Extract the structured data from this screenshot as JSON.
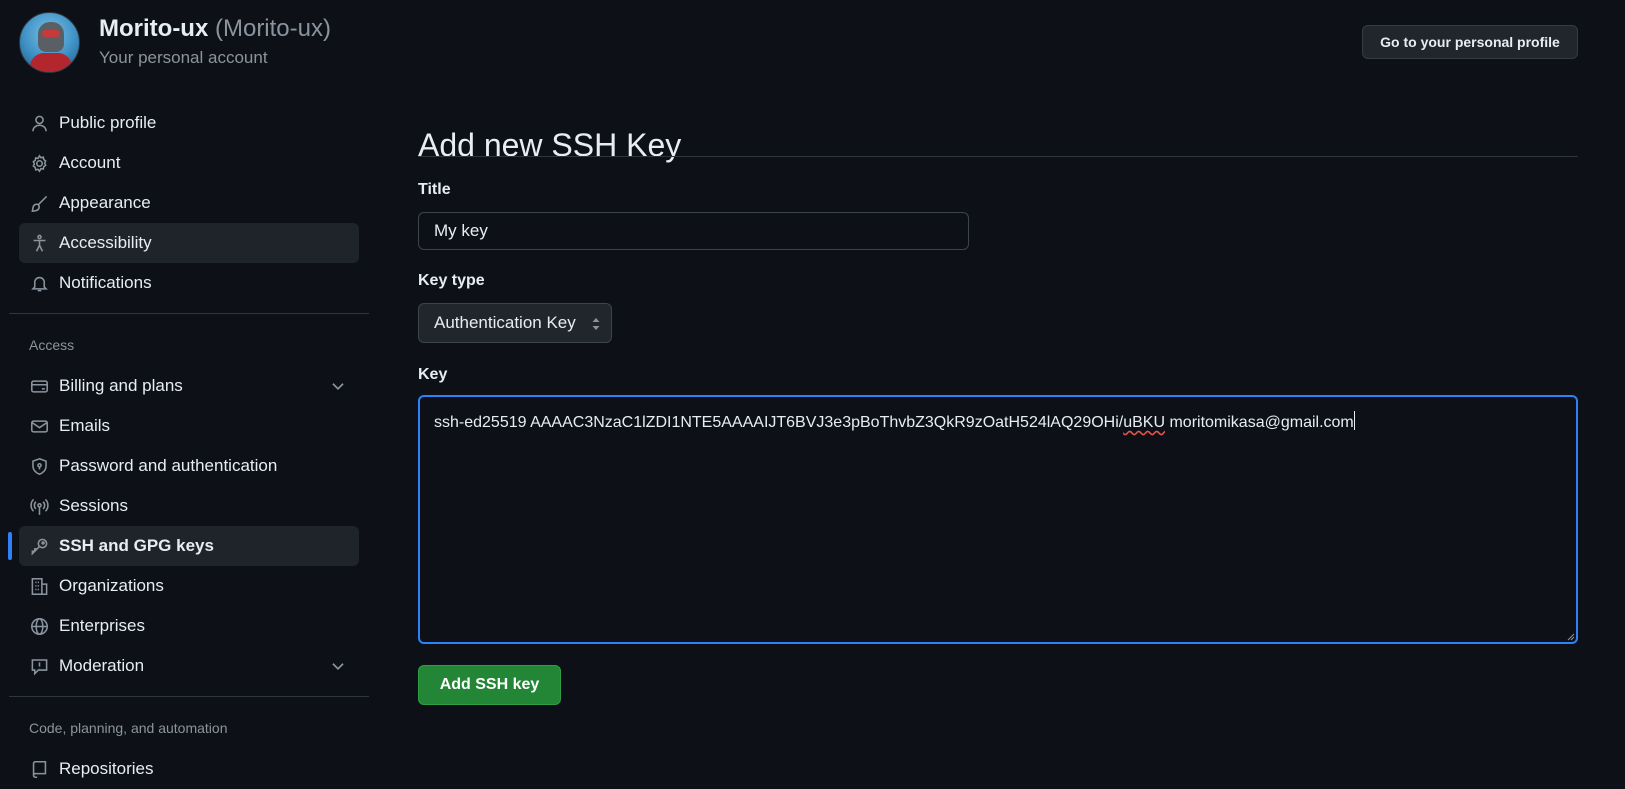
{
  "account": {
    "name": "Morito-ux",
    "handle": "(Morito-ux)",
    "subtitle": "Your personal account",
    "profile_button": "Go to your personal profile"
  },
  "sidebar": {
    "items": [
      {
        "label": "Public profile",
        "icon": "person-icon"
      },
      {
        "label": "Account",
        "icon": "gear-icon"
      },
      {
        "label": "Appearance",
        "icon": "paintbrush-icon"
      },
      {
        "label": "Accessibility",
        "icon": "accessibility-icon",
        "hover": true
      },
      {
        "label": "Notifications",
        "icon": "bell-icon"
      }
    ],
    "access_label": "Access",
    "access_items": [
      {
        "label": "Billing and plans",
        "icon": "credit-card-icon",
        "expandable": true
      },
      {
        "label": "Emails",
        "icon": "mail-icon"
      },
      {
        "label": "Password and authentication",
        "icon": "shield-lock-icon"
      },
      {
        "label": "Sessions",
        "icon": "broadcast-icon"
      },
      {
        "label": "SSH and GPG keys",
        "icon": "key-icon",
        "selected": true
      },
      {
        "label": "Organizations",
        "icon": "organization-icon"
      },
      {
        "label": "Enterprises",
        "icon": "globe-icon"
      },
      {
        "label": "Moderation",
        "icon": "report-icon",
        "expandable": true
      }
    ],
    "code_label": "Code, planning, and automation",
    "code_items": [
      {
        "label": "Repositories",
        "icon": "repo-icon"
      }
    ]
  },
  "form": {
    "heading": "Add new SSH Key",
    "title_label": "Title",
    "title_value": "My key",
    "key_type_label": "Key type",
    "key_type_value": "Authentication Key",
    "key_label": "Key",
    "key_value_part1": "ssh-ed25519 AAAAC3NzaC1lZDI1NTE5AAAAIJT6BVJ3e3pBoThvbZ3QkR9zOatH524lAQ29OHi/",
    "key_value_misspelled": "uBKU",
    "key_value_part2": " moritomikasa@gmail.com",
    "submit_label": "Add SSH key"
  },
  "colors": {
    "background": "#0d1117",
    "accent_blue": "#2f81f7",
    "button_green": "#238636",
    "muted_text": "#8b949e"
  }
}
